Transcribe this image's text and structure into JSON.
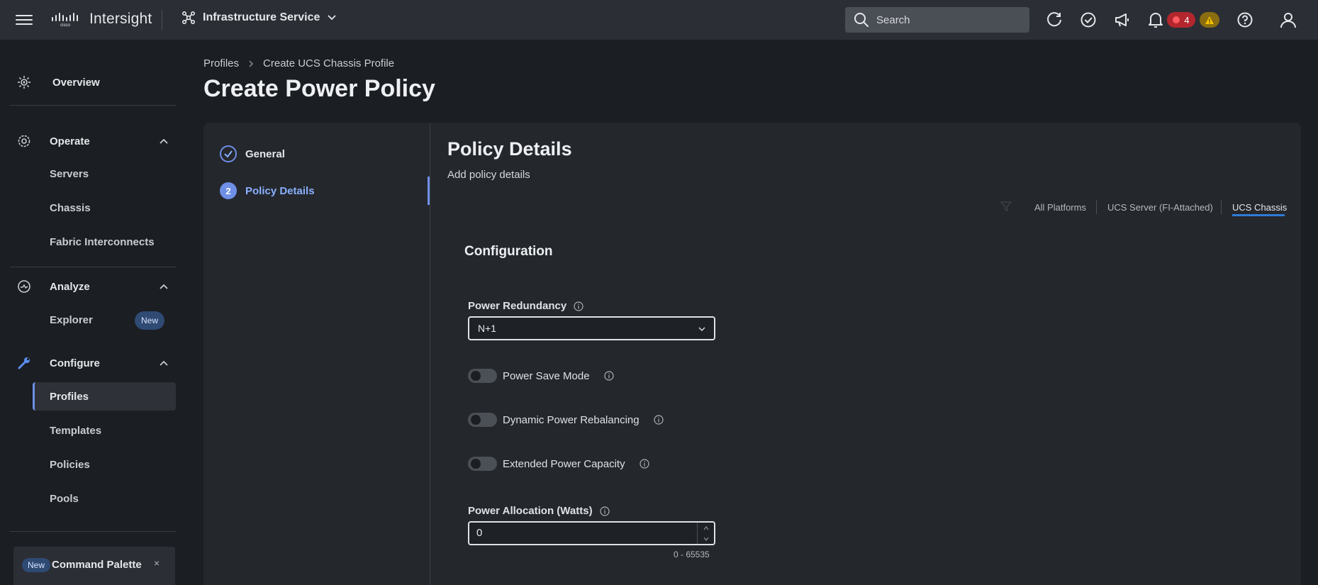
{
  "topbar": {
    "app_name": "Intersight",
    "service": "Infrastructure Service",
    "search_placeholder": "Search",
    "critical_count": "4",
    "icons": [
      "hamburger-icon",
      "cisco-logo",
      "service-icon",
      "chevron-down-icon",
      "search-icon",
      "refresh-icon",
      "check-circle-icon",
      "megaphone-icon",
      "bell-icon",
      "alert-critical-icon",
      "warning-icon",
      "help-icon",
      "user-icon"
    ],
    "colors": {
      "critical": "#b3262d",
      "warning": "#8a6d10"
    }
  },
  "sidebar": {
    "overview": "Overview",
    "operate": {
      "label": "Operate",
      "items": [
        "Servers",
        "Chassis",
        "Fabric Interconnects"
      ]
    },
    "analyze": {
      "label": "Analyze",
      "items": [
        "Explorer"
      ],
      "explorer_badge": "New"
    },
    "configure": {
      "label": "Configure",
      "items": [
        "Profiles",
        "Templates",
        "Policies",
        "Pools"
      ],
      "selected": "Profiles"
    },
    "command_palette": {
      "badge": "New",
      "label": "Command Palette",
      "close": "×"
    }
  },
  "breadcrumb": [
    "Profiles",
    "Create UCS Chassis Profile"
  ],
  "page_title": "Create Power Policy",
  "steps": [
    {
      "label": "General",
      "state": "done"
    },
    {
      "number": "2",
      "label": "Policy Details",
      "state": "active"
    }
  ],
  "details": {
    "title": "Policy Details",
    "subtitle": "Add policy details",
    "platforms": [
      "All Platforms",
      "UCS Server (FI-Attached)",
      "UCS Chassis"
    ],
    "active_platform": "UCS Chassis",
    "configuration_title": "Configuration",
    "power_redundancy": {
      "label": "Power Redundancy",
      "value": "N+1"
    },
    "toggles": [
      {
        "label": "Power Save Mode",
        "on": false
      },
      {
        "label": "Dynamic Power Rebalancing",
        "on": false
      },
      {
        "label": "Extended Power Capacity",
        "on": false
      }
    ],
    "power_allocation": {
      "label": "Power Allocation (Watts)",
      "value": "0",
      "range": "0 - 65535"
    }
  },
  "accent_color": "#6f8fe6"
}
